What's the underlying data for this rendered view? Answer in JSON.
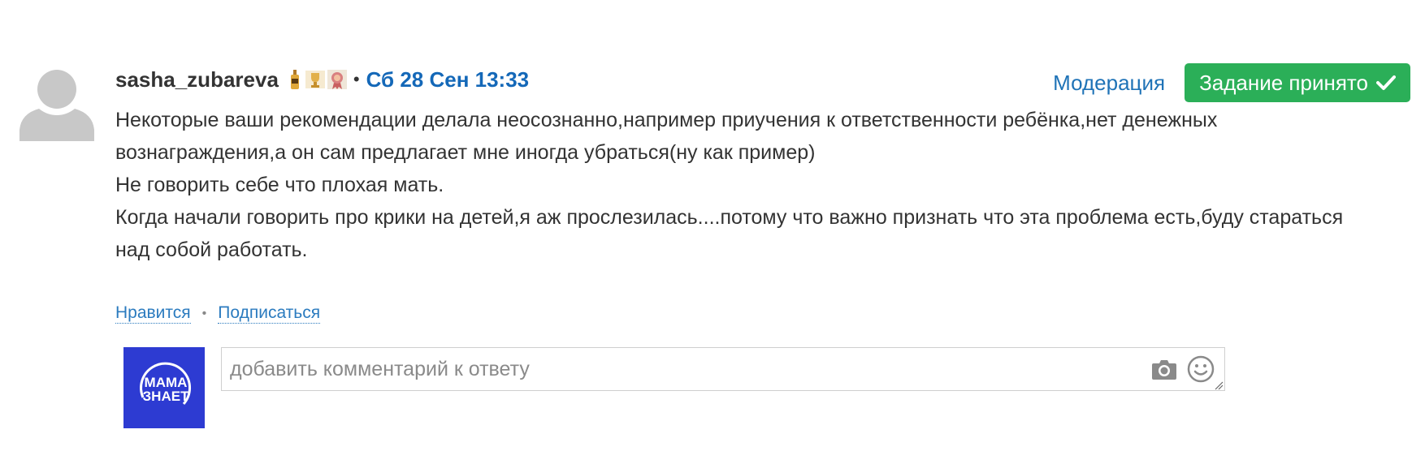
{
  "post": {
    "username": "sasha_zubareva",
    "separator": "•",
    "date": "Сб 28 Сен 13:33",
    "badges": [
      "bottle-badge-icon",
      "trophy-badge-icon",
      "ribbon-badge-icon"
    ],
    "body_lines": [
      "Некоторые ваши рекомендации делала неосознанно,например приучения к ответственности ребёнка,нет денежных вознаграждения,а он сам предлагает мне иногда убраться(ну как пример)",
      "Не говорить себе что плохая мать.",
      "Когда начали говорить про крики на детей,я аж прослезилась....потому что важно признать что эта проблема есть,буду стараться над собой работать."
    ]
  },
  "actions": {
    "moderation_label": "Модерация",
    "accepted_label": "Задание принято"
  },
  "footer": {
    "like_label": "Нравится",
    "separator": "•",
    "subscribe_label": "Подписаться"
  },
  "logo": {
    "line1": "МАМА",
    "line2": "ЗНАЕТ"
  },
  "comment": {
    "placeholder": "добавить комментарий к ответу"
  },
  "colors": {
    "accent_blue": "#1468b8",
    "link_blue": "#2b7bbf",
    "success_green": "#2baf58",
    "logo_bg": "#2d3bd2",
    "avatar_gray": "#c8c8c8"
  }
}
